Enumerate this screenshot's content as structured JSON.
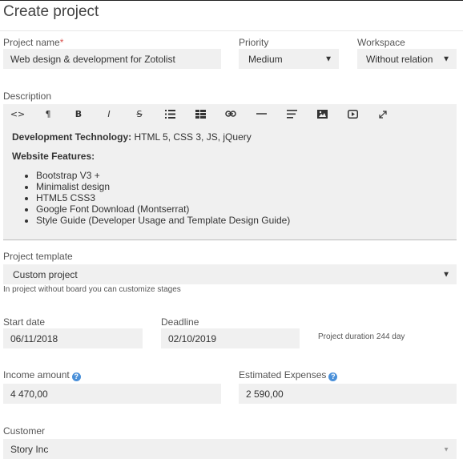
{
  "page": {
    "title": "Create project"
  },
  "project_name": {
    "label": "Project name",
    "required_mark": "*",
    "value": "Web design & development for Zotolist"
  },
  "priority": {
    "label": "Priority",
    "value": "Medium"
  },
  "workspace": {
    "label": "Workspace",
    "value": "Without relation"
  },
  "description": {
    "label": "Description",
    "toolbar": [
      "code-view",
      "paragraph",
      "bold",
      "italic",
      "strikethrough",
      "unordered-list",
      "table",
      "link",
      "horizontal-rule",
      "align",
      "image",
      "video",
      "fullscreen"
    ],
    "tech_label": "Development Technology:",
    "tech_value": " HTML 5, CSS 3, JS, jQuery",
    "features_label": "Website Features:",
    "features": [
      "Bootstrap V3 +",
      "Minimalist design",
      "HTML5 CSS3",
      "Google Font Download (Montserrat)",
      "Style Guide (Developer Usage and Template Design Guide)"
    ]
  },
  "project_template": {
    "label": "Project template",
    "value": "Custom project",
    "hint": "In project without board you can customize stages"
  },
  "start_date": {
    "label": "Start date",
    "value": "06/11/2018"
  },
  "deadline": {
    "label": "Deadline",
    "value": "02/10/2019"
  },
  "duration": {
    "text": "Project duration 244 day"
  },
  "income_amount": {
    "label": "Income amount",
    "value": "4 470,00"
  },
  "estimated_expenses": {
    "label": "Estimated Expenses",
    "value": "2 590,00"
  },
  "customer": {
    "label": "Customer",
    "value": "Story Inc"
  },
  "colors": {
    "field_bg": "#f0f0f0",
    "required": "#d9534f",
    "help": "#4a90d9"
  }
}
